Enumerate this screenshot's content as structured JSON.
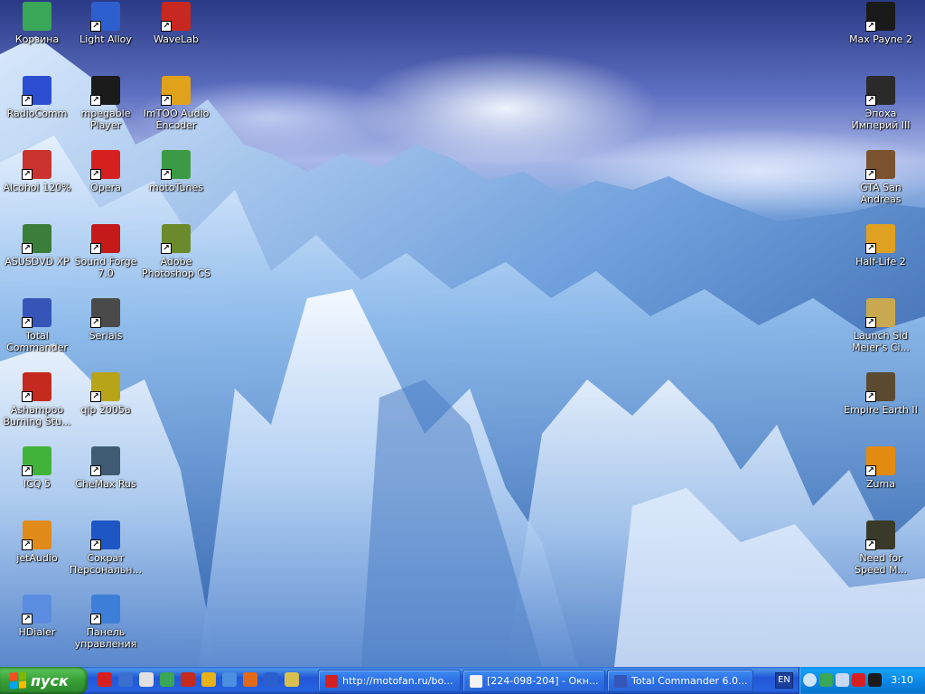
{
  "desktop": {
    "icons_left": [
      {
        "label": "Корзина",
        "icon": "recycle-bin-icon",
        "color": "#3aa657"
      },
      {
        "label": "RadioComm",
        "icon": "radiocomm-icon",
        "color": "#2b4fd0"
      },
      {
        "label": "Alcohol 120%",
        "icon": "alcohol-icon",
        "color": "#c9322f"
      },
      {
        "label": "ASUSDVD XP",
        "icon": "asusdvd-icon",
        "color": "#3b7d3a"
      },
      {
        "label": "Total Commander",
        "icon": "total-commander-icon",
        "color": "#3556b8"
      },
      {
        "label": "Ashampoo Burning Stu...",
        "icon": "ashampoo-icon",
        "color": "#c52a1e"
      },
      {
        "label": "ICQ 5",
        "icon": "icq-icon",
        "color": "#41b33a"
      },
      {
        "label": "jetAudio",
        "icon": "jetaudio-icon",
        "color": "#e08a1a"
      },
      {
        "label": "HDialer",
        "icon": "hdialer-icon",
        "color": "#5a8de0"
      }
    ],
    "icons_col2": [
      {
        "label": "Light Alloy",
        "icon": "light-alloy-icon",
        "color": "#2e5fcf"
      },
      {
        "label": "mpegable Player",
        "icon": "mpegable-icon",
        "color": "#1b1b1b"
      },
      {
        "label": "Opera",
        "icon": "opera-icon",
        "color": "#d62020"
      },
      {
        "label": "Sound Forge 7.0",
        "icon": "sound-forge-icon",
        "color": "#c41a1a"
      },
      {
        "label": "Serials",
        "icon": "serials-icon",
        "color": "#4a4a4a"
      },
      {
        "label": "qip 2005a",
        "icon": "qip-icon",
        "color": "#b8a418"
      },
      {
        "label": "CheMax Rus",
        "icon": "chemax-icon",
        "color": "#3f5a73"
      },
      {
        "label": "Сократ Персональн...",
        "icon": "sokrat-icon",
        "color": "#1e56c4"
      },
      {
        "label": "Панель управления",
        "icon": "control-panel-icon",
        "color": "#3d7fd8"
      }
    ],
    "icons_col3": [
      {
        "label": "WaveLab",
        "icon": "wavelab-icon",
        "color": "#c7281f"
      },
      {
        "label": "ImTOO Audio Encoder",
        "icon": "imtoo-icon",
        "color": "#e0a21a"
      },
      {
        "label": "motoTunes",
        "icon": "mototunes-icon",
        "color": "#3c9a45"
      },
      {
        "label": "Adobe Photoshop CS",
        "icon": "photoshop-icon",
        "color": "#6b8a2c"
      }
    ],
    "icons_right": [
      {
        "label": "Max Payne 2",
        "icon": "max-payne-icon",
        "color": "#1a1a1a"
      },
      {
        "label": "Эпоха Империй III",
        "icon": "age-of-empires-icon",
        "color": "#2a2a2a"
      },
      {
        "label": "GTA San Andreas",
        "icon": "gta-icon",
        "color": "#7a5230"
      },
      {
        "label": "Half-Life 2",
        "icon": "half-life-icon",
        "color": "#e0a020"
      },
      {
        "label": "Launch Sid Meier's Ci...",
        "icon": "civilization-icon",
        "color": "#c9a850"
      },
      {
        "label": "Empire Earth II",
        "icon": "empire-earth-icon",
        "color": "#5a4a30"
      },
      {
        "label": "Zuma",
        "icon": "zuma-icon",
        "color": "#e38a10"
      },
      {
        "label": "Need for Speed M...",
        "icon": "nfs-icon",
        "color": "#3a3a2a"
      }
    ]
  },
  "taskbar": {
    "start_label": "пуск",
    "quicklaunch": [
      {
        "icon": "opera-ql-icon",
        "color": "#d62020"
      },
      {
        "icon": "outlook-ql-icon",
        "color": "#3a6fd0"
      },
      {
        "icon": "network-ql-icon",
        "color": "#e0e0e0"
      },
      {
        "icon": "globe-ql-icon",
        "color": "#3aa657"
      },
      {
        "icon": "ashampoo-ql-icon",
        "color": "#c52a1e"
      },
      {
        "icon": "media-player-ql-icon",
        "color": "#e8b21a"
      },
      {
        "icon": "notepad-ql-icon",
        "color": "#4a8fe0"
      },
      {
        "icon": "firefox-ql-icon",
        "color": "#e06a1a"
      },
      {
        "icon": "word-ql-icon",
        "color": "#2b5fcc"
      },
      {
        "icon": "archive-ql-icon",
        "color": "#d8c050"
      }
    ],
    "tasks": [
      {
        "label": "http://motofan.ru/bo...",
        "icon": "opera-task-icon",
        "color": "#d62020"
      },
      {
        "label": "[224-098-204] - Окн...",
        "icon": "mail-task-icon",
        "color": "#f2f2f2"
      },
      {
        "label": "Total Commander 6.0...",
        "icon": "tc-task-icon",
        "color": "#3556b8"
      }
    ],
    "language": "EN",
    "tray_icons": [
      {
        "icon": "tray-arrow-icon",
        "color": "#cfe3fb"
      },
      {
        "icon": "tray-clover-icon",
        "color": "#3aa657"
      },
      {
        "icon": "tray-network-icon",
        "color": "#c8d8f0"
      },
      {
        "icon": "tray-kaspersky-icon",
        "color": "#d62020"
      },
      {
        "icon": "tray-app-icon",
        "color": "#1b1b1b"
      }
    ],
    "clock": "3:10"
  }
}
